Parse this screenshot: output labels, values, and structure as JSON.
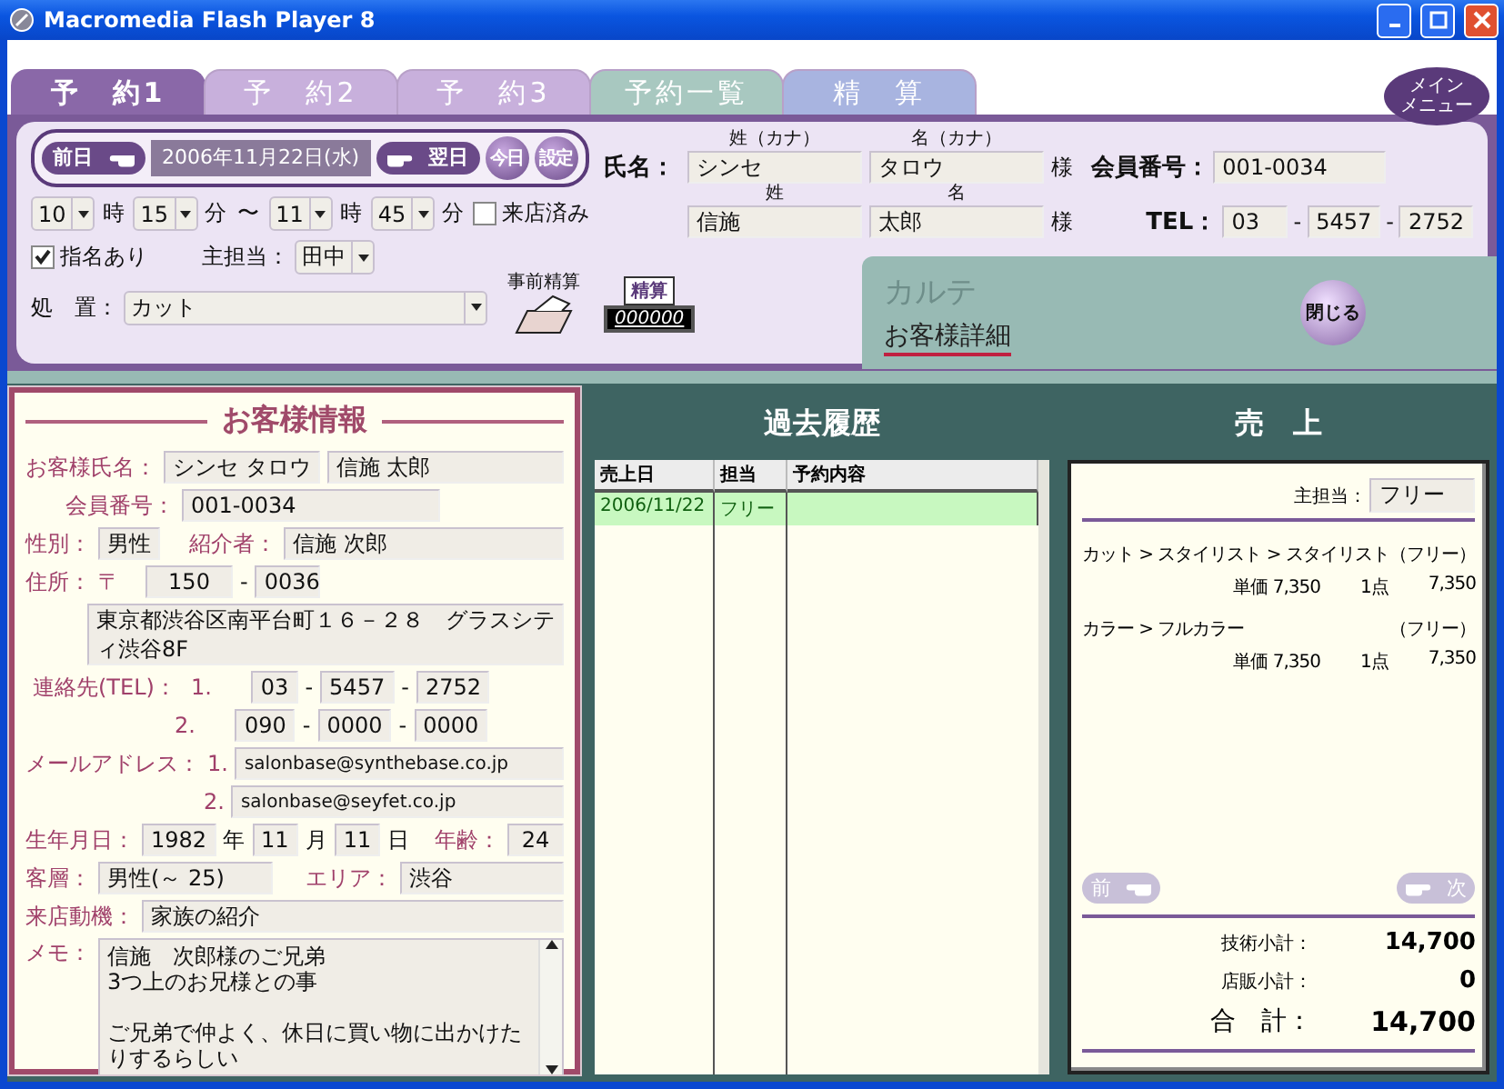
{
  "window": {
    "title": "Macromedia Flash Player 8"
  },
  "tabs": [
    {
      "label": "予　約1",
      "selected": true,
      "color": "#8a68a8"
    },
    {
      "label": "予　約2",
      "selected": false,
      "color": "#c8b0dc"
    },
    {
      "label": "予　約3",
      "selected": false,
      "color": "#c8b0dc"
    },
    {
      "label": "予約一覧",
      "selected": false,
      "color": "#a8c8c0"
    },
    {
      "label": "精　算",
      "selected": false,
      "color": "#a8b4e0"
    }
  ],
  "menu_button": {
    "lines": [
      "メイン",
      "メニュー"
    ]
  },
  "reservation": {
    "prev_day": "前日",
    "date": "2006年11月22日(水)",
    "next_day": "翌日",
    "today": "今日",
    "settings": "設定",
    "start_hour": "10",
    "start_hour_unit": "時",
    "start_minute": "15",
    "start_minute_unit": "分",
    "range_mark": "〜",
    "end_hour": "11",
    "end_hour_unit": "時",
    "end_minute": "45",
    "end_minute_unit": "分",
    "visited": {
      "label": "来店済み",
      "checked": false
    },
    "nominated": {
      "label": "指名あり",
      "checked": true
    },
    "staff_label": "主担当：",
    "staff": "田中",
    "treatment_label": "処　置：",
    "treatment": "カット",
    "prepay": "事前精算",
    "settle": "精算",
    "settle_number": "000000"
  },
  "customer_header": {
    "name_label": "氏名：",
    "kana_last_label": "姓（カナ）",
    "kana_first_label": "名（カナ）",
    "kana_last": "シンセ",
    "kana_first": "タロウ",
    "kana_honorific": "様",
    "last_label": "姓",
    "first_label": "名",
    "last": "信施",
    "first": "太郎",
    "honorific": "様",
    "member_label": "会員番号：",
    "member": "001-0034",
    "tel_label": "TEL：",
    "tel": [
      "03",
      "5457",
      "2752"
    ],
    "tel_separators": [
      "-",
      "-"
    ]
  },
  "karte": {
    "title": "カルテ",
    "subtitle": "お客様詳細",
    "close": "閉じる"
  },
  "customer_info": {
    "title": "お客様情報",
    "name": {
      "label": "お客様氏名：",
      "kana": "シンセ タロウ",
      "kanji": "信施 太郎"
    },
    "member": {
      "label": "会員番号：",
      "value": "001-0034"
    },
    "gender": {
      "label": "性別：",
      "value": "男性"
    },
    "referrer": {
      "label": "紹介者：",
      "value": "信施 次郎"
    },
    "address": {
      "label": "住所：",
      "postal_mark": "〒",
      "postal": [
        "150",
        "0036"
      ],
      "postal_separator": "-",
      "value": "東京都渋谷区南平台町１６－２８　グラスシティ渋谷8F"
    },
    "phones": {
      "label": "連絡先(TEL)：",
      "entries": [
        {
          "index": "1.",
          "parts": [
            "03",
            "5457",
            "2752"
          ],
          "separators": [
            "-",
            "-"
          ]
        },
        {
          "index": "2.",
          "parts": [
            "090",
            "0000",
            "0000"
          ],
          "separators": [
            "-",
            "-"
          ]
        }
      ]
    },
    "emails": {
      "label": "メールアドレス：",
      "entries": [
        {
          "index": "1.",
          "value": "salonbase@synthebase.co.jp"
        },
        {
          "index": "2.",
          "value": "salonbase@seyfet.co.jp"
        }
      ]
    },
    "birthday": {
      "label": "生年月日：",
      "year": "1982",
      "year_unit": "年",
      "month": "11",
      "month_unit": "月",
      "day": "11",
      "day_unit": "日"
    },
    "age": {
      "label": "年齢：",
      "value": "24"
    },
    "segment": {
      "label": "客層：",
      "value": "男性(～ 25)"
    },
    "area": {
      "label": "エリア：",
      "value": "渋谷"
    },
    "motive": {
      "label": "来店動機：",
      "value": "家族の紹介"
    },
    "memo": {
      "label": "メモ：",
      "paragraphs": [
        [
          "信施　次郎様のご兄弟",
          "3つ上のお兄様との事"
        ],
        [
          "ご兄弟で仲よく、休日に買い物に出かけたりするらしい"
        ]
      ]
    }
  },
  "history": {
    "title": "過去履歴",
    "columns": [
      "売上日",
      "担当",
      "予約内容"
    ],
    "rows": [
      {
        "cells": [
          "2006/11/22",
          "フリー",
          ""
        ],
        "selected": true
      }
    ]
  },
  "sales": {
    "title": "売　上",
    "staff_label": "主担当：",
    "staff": "フリー",
    "items": [
      {
        "name": "カット > スタイリスト > スタイリスト",
        "staff": "（フリー）",
        "unit_label": "単価",
        "price": "7,350",
        "quantity": "1点",
        "amount": "7,350"
      },
      {
        "name": "カラー > フルカラー",
        "staff": "（フリー）",
        "unit_label": "単価",
        "price": "7,350",
        "quantity": "1点",
        "amount": "7,350"
      }
    ],
    "prev": {
      "label": "前",
      "disabled": true
    },
    "next": {
      "label": "次",
      "disabled": true
    },
    "totals": [
      {
        "kind": "subtotal",
        "label": "技術小計：",
        "value": "14,700"
      },
      {
        "kind": "subtotal",
        "label": "店販小計：",
        "value": "0"
      },
      {
        "kind": "grand",
        "label": "合　計：",
        "value": "14,700"
      }
    ]
  }
}
